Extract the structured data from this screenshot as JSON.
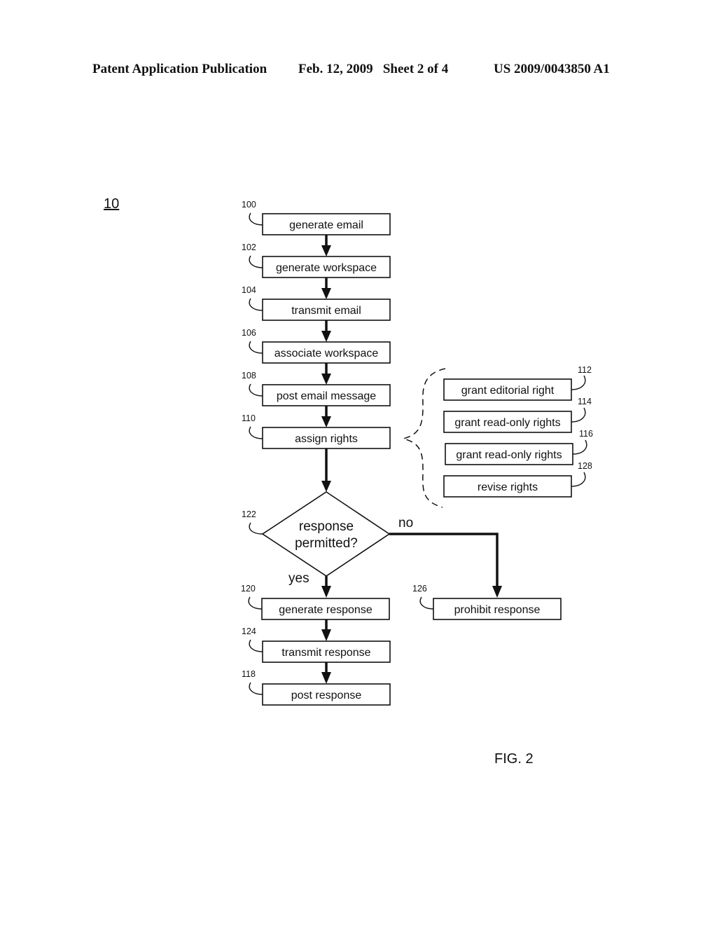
{
  "header": {
    "publication": "Patent Application Publication",
    "date_sheet": "Feb. 12, 2009   Sheet 2 of 4",
    "number": "US 2009/0043850 A1"
  },
  "figure": {
    "ref": "10",
    "label": "FIG. 2"
  },
  "steps": [
    {
      "id": "100",
      "label": "generate email"
    },
    {
      "id": "102",
      "label": "generate workspace"
    },
    {
      "id": "104",
      "label": "transmit email"
    },
    {
      "id": "106",
      "label": "associate workspace"
    },
    {
      "id": "108",
      "label": "post email message"
    },
    {
      "id": "110",
      "label": "assign rights"
    }
  ],
  "rights": [
    {
      "id": "112",
      "label": "grant editorial right"
    },
    {
      "id": "114",
      "label": "grant read-only rights"
    },
    {
      "id": "116",
      "label": "grant read-only rights"
    },
    {
      "id": "128",
      "label": "revise rights"
    }
  ],
  "decision": {
    "id": "122",
    "line1": "response",
    "line2": "permitted?",
    "yes": "yes",
    "no": "no"
  },
  "yes_steps": [
    {
      "id": "120",
      "label": "generate response"
    },
    {
      "id": "124",
      "label": "transmit response"
    },
    {
      "id": "118",
      "label": "post response"
    }
  ],
  "no_step": {
    "id": "126",
    "label": "prohibit response"
  }
}
